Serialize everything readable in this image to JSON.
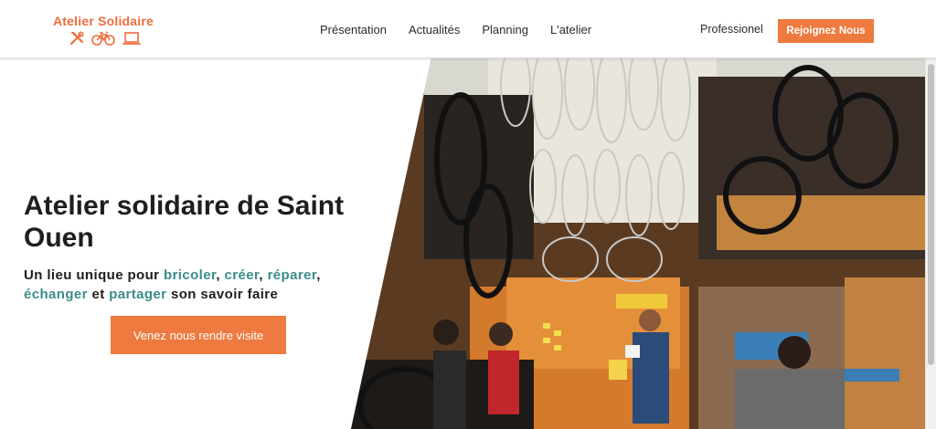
{
  "header": {
    "logo_title": "Atelier Solidaire",
    "logo_icons": [
      "tools-icon",
      "bicycle-icon",
      "laptop-icon"
    ],
    "nav": [
      {
        "label": "Présentation"
      },
      {
        "label": "Actualités"
      },
      {
        "label": "Planning"
      },
      {
        "label": "L'atelier"
      }
    ],
    "pro_link": "Professionel",
    "join_button": "Rejoignez Nous"
  },
  "hero": {
    "title": "Atelier solidaire de Saint Ouen",
    "subtitle": {
      "p1": "Un lieu unique pour ",
      "w1": "bricoler",
      "p2": ", ",
      "w2": "créer",
      "p3": ", ",
      "w3": "réparer",
      "p4": ", ",
      "w4": "échanger",
      "p5": " et ",
      "w5": "partager",
      "p6": " son savoir faire"
    },
    "button": "Venez nous rendre visite",
    "image_alt": "Workshop interior with bicycle wheels hanging from the ceiling and people repairing bikes"
  },
  "colors": {
    "accent": "#ee7a3f",
    "logo": "#ee6c3b",
    "highlight": "#3a8c8a",
    "text": "#1e1e1e"
  }
}
